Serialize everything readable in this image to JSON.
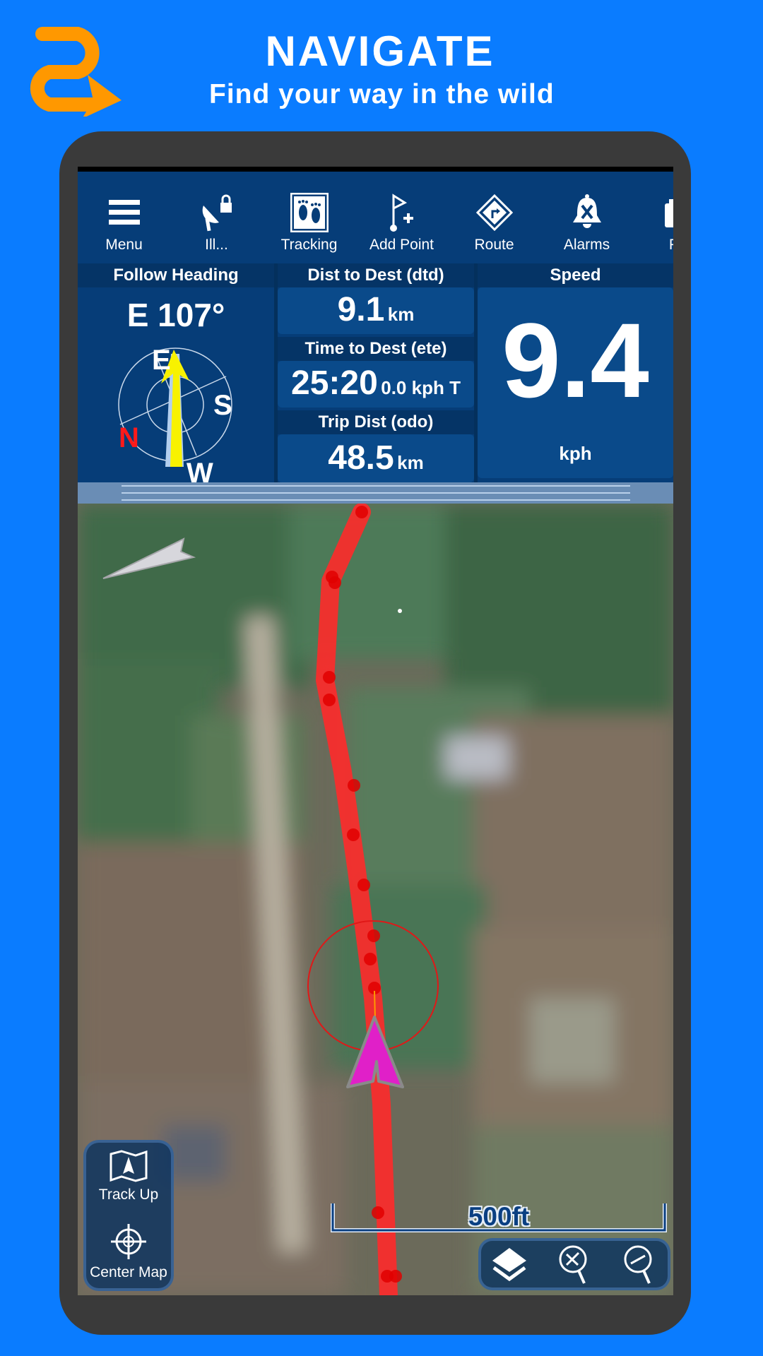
{
  "hero": {
    "title": "NAVIGATE",
    "subtitle": "Find your way in the wild",
    "logo_icon": "route-arrow-logo-icon",
    "logo_color": "#ff9800"
  },
  "toolbar": {
    "items": [
      {
        "label": "Menu",
        "icon": "hamburger-menu-icon"
      },
      {
        "label": "Ill...",
        "icon": "satellite-dish-lock-icon"
      },
      {
        "label": "Tracking",
        "icon": "footprints-icon"
      },
      {
        "label": "Add Point",
        "icon": "flag-plus-icon"
      },
      {
        "label": "Route",
        "icon": "route-sign-icon"
      },
      {
        "label": "Alarms",
        "icon": "bell-off-icon"
      },
      {
        "label": "Pic",
        "icon": "camera-icon"
      }
    ]
  },
  "dashboard": {
    "heading": {
      "title": "Follow Heading",
      "value": "E 107°",
      "compass": {
        "n": "N",
        "e": "E",
        "s": "S",
        "w": "W"
      }
    },
    "dtd": {
      "title": "Dist to Dest (dtd)",
      "value": "9.1",
      "unit": "km"
    },
    "ete": {
      "title": "Time to Dest (ete)",
      "value": "25:20",
      "unit": "0.0 kph T"
    },
    "odo": {
      "title": "Trip Dist (odo)",
      "value": "48.5",
      "unit": "km"
    },
    "speed": {
      "title": "Speed",
      "value": "9.4",
      "unit": "kph"
    }
  },
  "map": {
    "scale_label": "500ft",
    "route_color": "#ff2222",
    "position_marker_color": "#e020c8",
    "left_controls": [
      {
        "label": "Track Up",
        "icon": "map-track-up-icon"
      },
      {
        "label": "Center Map",
        "icon": "crosshair-icon"
      }
    ],
    "right_controls": [
      {
        "icon": "layers-icon"
      },
      {
        "icon": "zoom-in-icon"
      },
      {
        "icon": "zoom-out-icon"
      }
    ]
  },
  "colors": {
    "background": "#0a7cff",
    "panel": "#063d78",
    "phone_frame": "#3a3a3a"
  }
}
